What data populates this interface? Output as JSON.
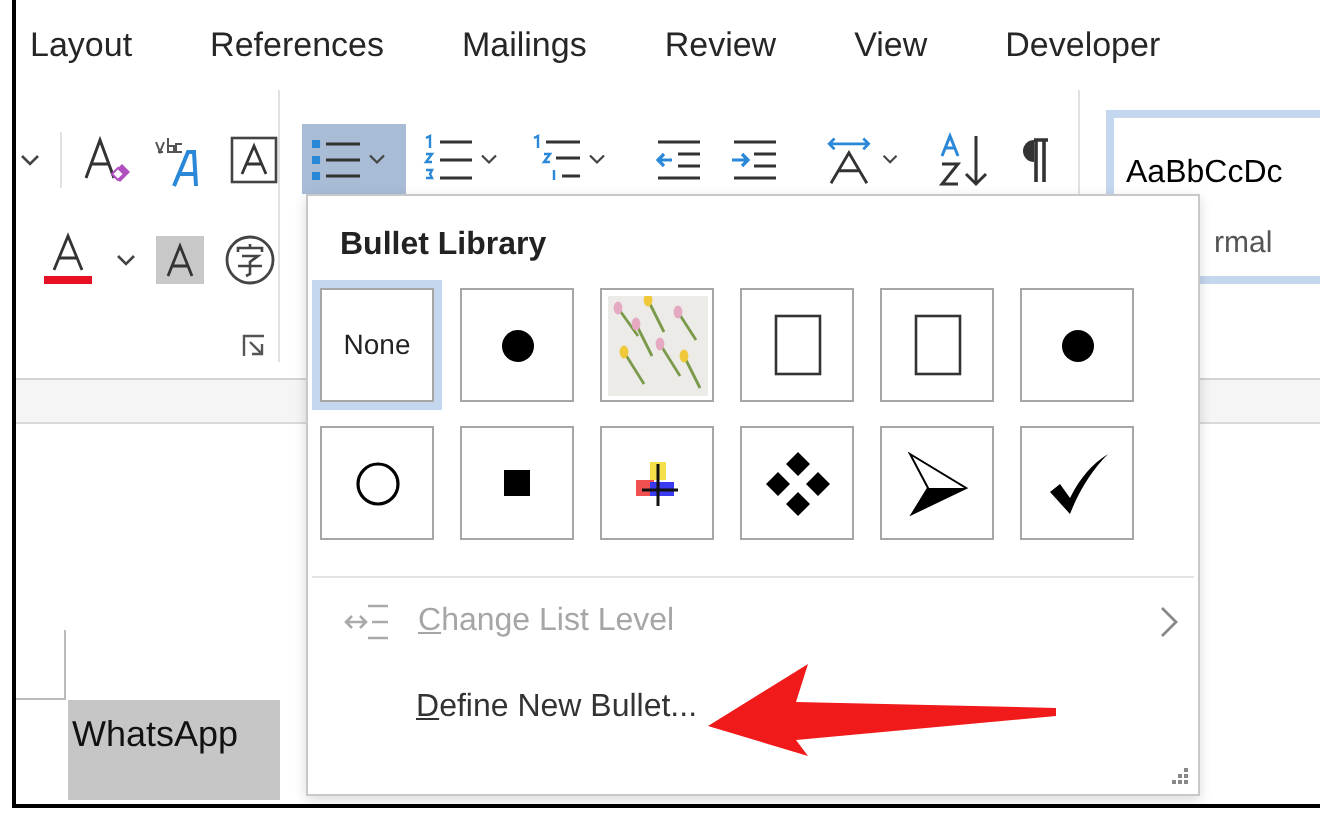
{
  "ribbon_tabs": [
    {
      "label": "Layout"
    },
    {
      "label": "References"
    },
    {
      "label": "Mailings"
    },
    {
      "label": "Review"
    },
    {
      "label": "View"
    },
    {
      "label": "Developer"
    }
  ],
  "paragraph_buttons": [
    {
      "kind": "bullets",
      "selected": true
    },
    {
      "kind": "numbering",
      "selected": false
    },
    {
      "kind": "multilevel",
      "selected": false
    },
    {
      "kind": "decrease-indent",
      "selected": false
    },
    {
      "kind": "increase-indent",
      "selected": false
    },
    {
      "kind": "text-direction",
      "selected": false
    },
    {
      "kind": "sort",
      "selected": false
    },
    {
      "kind": "pilcrow",
      "selected": false
    }
  ],
  "styles_gallery": {
    "preview": "AaBbCcDc",
    "style_name": "rmal",
    "selected": true
  },
  "bullet_menu": {
    "title": "Bullet Library",
    "bullets": [
      {
        "kind": "none",
        "label": "None",
        "selected": true
      },
      {
        "kind": "dot",
        "selected": false
      },
      {
        "kind": "picture",
        "selected": false
      },
      {
        "kind": "glyph-box",
        "selected": false
      },
      {
        "kind": "glyph-box",
        "selected": false
      },
      {
        "kind": "dot",
        "selected": false
      },
      {
        "kind": "circle",
        "selected": false
      },
      {
        "kind": "square",
        "selected": false
      },
      {
        "kind": "color-cross",
        "selected": false
      },
      {
        "kind": "diamonds",
        "selected": false
      },
      {
        "kind": "arrowhead",
        "selected": false
      },
      {
        "kind": "check",
        "selected": false
      }
    ],
    "items": [
      {
        "label": "Change List Level",
        "disabled": true,
        "submenu": true
      },
      {
        "label": "Define New Bullet...",
        "disabled": false,
        "submenu": false
      }
    ]
  },
  "document": {
    "text": "WhatsApp",
    "highlighted": true
  },
  "annotations": [
    {
      "kind": "arrow"
    }
  ]
}
